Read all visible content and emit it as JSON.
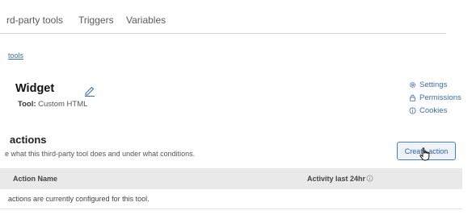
{
  "tabs": [
    "rd-party tools",
    "Triggers",
    "Variables"
  ],
  "breadcrumb": {
    "link": "tools"
  },
  "widget": {
    "title": "Widget",
    "tool_label": "Tool:",
    "tool_value": "Custom HTML"
  },
  "side_links": {
    "settings": "Settings",
    "permissions": "Permissions",
    "cookies": "Cookies"
  },
  "actions_section": {
    "title": "actions",
    "description": "e what this third-party tool does and under what conditions.",
    "create_button": "Create action"
  },
  "table": {
    "columns": [
      "Action Name",
      "Activity last 24hr"
    ],
    "empty_message": "actions are currently configured for this tool."
  },
  "icons": {
    "edit": "pencil-icon",
    "settings": "gear-icon",
    "permissions": "lock-icon",
    "cookies": "info-icon",
    "cursor": "hand-pointer-icon",
    "activity_info": "info-circle-icon"
  },
  "colors": {
    "link": "#3b6eb0",
    "button_border": "#4a7fc1",
    "header_bg": "#e9e9e9"
  }
}
